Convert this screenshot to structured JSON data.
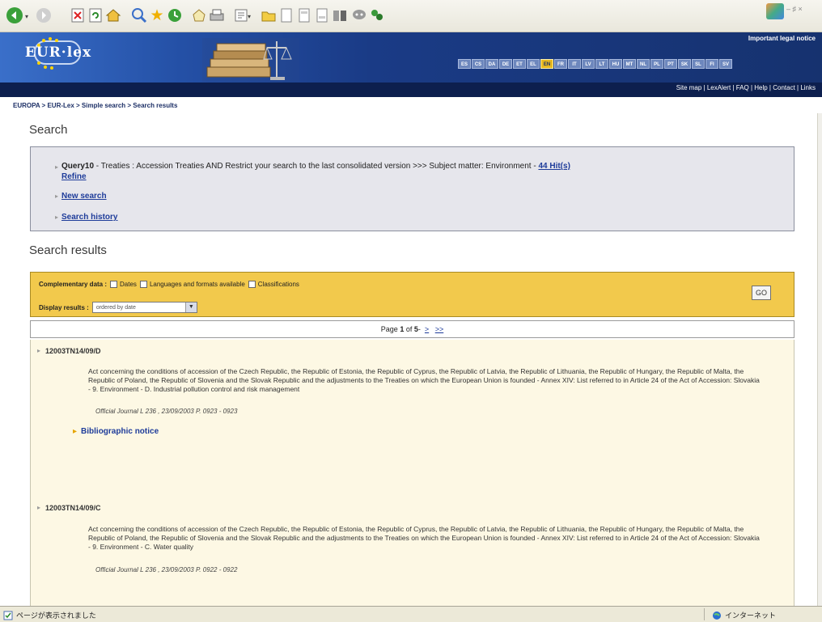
{
  "banner": {
    "legal_notice": "Important legal notice",
    "languages": [
      "ES",
      "CS",
      "DA",
      "DE",
      "ET",
      "EL",
      "EN",
      "FR",
      "IT",
      "LV",
      "LT",
      "HU",
      "MT",
      "NL",
      "PL",
      "PT",
      "SK",
      "SL",
      "FI",
      "SV"
    ],
    "active_language": "EN",
    "toplinks": "Site map | LexAlert | FAQ | Help | Contact | Links"
  },
  "breadcrumb": "EUROPA > EUR-Lex > Simple search > Search results",
  "search": {
    "title": "Search",
    "query_label": "Query10",
    "query_text": " - Treaties : Accession Treaties AND Restrict your search to the last consolidated version >>> Subject matter: Environment - ",
    "hits": "44 Hit(s)",
    "refine": "Refine",
    "new_search": "New search",
    "history": "Search history"
  },
  "results": {
    "title": "Search results",
    "complementary_label": "Complementary data :",
    "options": [
      "Dates",
      "Languages and formats available",
      "Classifications"
    ],
    "display_label": "Display results :",
    "display_value": "ordered by date",
    "go": "GO",
    "pager": {
      "prefix": "Page",
      "current": "1",
      "of": "of",
      "total": "5",
      "dash": "-",
      "next": ">",
      "last": ">>"
    },
    "items": [
      {
        "id": "12003TN14/09/D",
        "text": "Act concerning the conditions of accession of the Czech Republic, the Republic of Estonia, the Republic of Cyprus, the Republic of Latvia, the Republic of Lithuania, the Republic of Hungary, the Republic of Malta, the Republic of Poland, the Republic of Slovenia and the Slovak Republic and the adjustments to the Treaties on which the European Union is founded - Annex XIV: List referred to in Article 24 of the Act of Accession: Slovakia - 9. Environment - D. Industrial pollution control and risk management",
        "oj": "Official Journal L 236 , 23/09/2003 P. 0923 - 0923",
        "biblio": "Bibliographic notice"
      },
      {
        "id": "12003TN14/09/C",
        "text": "Act concerning the conditions of accession of the Czech Republic, the Republic of Estonia, the Republic of Cyprus, the Republic of Latvia, the Republic of Lithuania, the Republic of Hungary, the Republic of Malta, the Republic of Poland, the Republic of Slovenia and the Slovak Republic and the adjustments to the Treaties on which the European Union is founded - Annex XIV: List referred to in Article 24 of the Act of Accession: Slovakia - 9. Environment - C. Water quality",
        "oj": "Official Journal L 236 , 23/09/2003 P. 0922 - 0922"
      }
    ]
  },
  "statusbar": {
    "left": "ページが表示されました",
    "right": "インターネット"
  },
  "colors": {
    "banner": "#1d3a82",
    "search_box": "#e6e6ec",
    "complementary_box": "#f2c94c",
    "results_bg": "#fdf8e4",
    "link": "#1e3c9a"
  }
}
